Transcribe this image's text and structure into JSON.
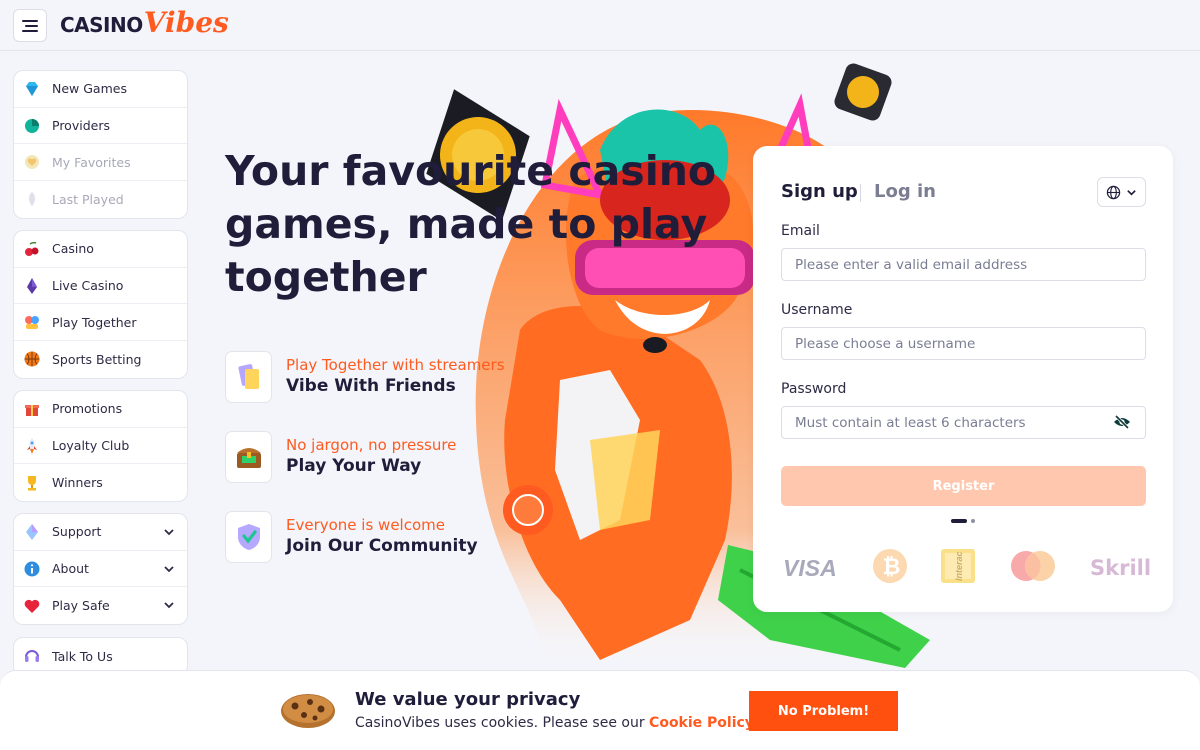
{
  "brand": {
    "logo_casino": "CASINO",
    "logo_vibes": "Vibes"
  },
  "sidebar": {
    "group1": [
      {
        "label": "New Games",
        "icon": "diamond-icon"
      },
      {
        "label": "Providers",
        "icon": "providers-icon"
      },
      {
        "label": "My Favorites",
        "icon": "heart-icon"
      },
      {
        "label": "Last Played",
        "icon": "history-icon"
      }
    ],
    "group2": [
      {
        "label": "Casino",
        "icon": "cherry-icon"
      },
      {
        "label": "Live Casino",
        "icon": "dealer-icon"
      },
      {
        "label": "Play Together",
        "icon": "play-together-icon"
      },
      {
        "label": "Sports Betting",
        "icon": "basketball-icon"
      }
    ],
    "group3": [
      {
        "label": "Promotions",
        "icon": "gift-icon"
      },
      {
        "label": "Loyalty Club",
        "icon": "rocket-icon"
      },
      {
        "label": "Winners",
        "icon": "trophy-icon"
      }
    ],
    "group4": [
      {
        "label": "Support",
        "icon": "support-icon"
      },
      {
        "label": "About",
        "icon": "info-icon"
      },
      {
        "label": "Play Safe",
        "icon": "heart-shield-icon"
      }
    ],
    "group5": [
      {
        "label": "Talk To Us",
        "icon": "headset-icon"
      }
    ]
  },
  "hero": {
    "title": "Your favourite casino games, made to play together",
    "features": [
      {
        "sub": "Play Together with streamers",
        "title": "Vibe With Friends",
        "icon": "cards-icon"
      },
      {
        "sub": "No jargon, no pressure",
        "title": "Play Your Way",
        "icon": "chest-icon"
      },
      {
        "sub": "Everyone is welcome",
        "title": "Join Our Community",
        "icon": "shield-check-icon"
      }
    ]
  },
  "signup": {
    "tab_signup": "Sign up",
    "tab_login": "Log in",
    "email_label": "Email",
    "email_placeholder": "Please enter a valid email address",
    "username_label": "Username",
    "username_placeholder": "Please choose a username",
    "password_label": "Password",
    "password_placeholder": "Must contain at least 6 characters",
    "register_label": "Register",
    "payments": [
      "VISA",
      "Bitcoin",
      "Interac",
      "Mastercard",
      "Skrill"
    ]
  },
  "cookie": {
    "title": "We value your privacy",
    "text": "CasinoVibes uses cookies. Please see our",
    "link": "Cookie Policy",
    "button": "No Problem!"
  },
  "colors": {
    "accent": "#ff5a1f",
    "dark": "#1f1d3a",
    "register_disabled": "#ffc8ae"
  }
}
